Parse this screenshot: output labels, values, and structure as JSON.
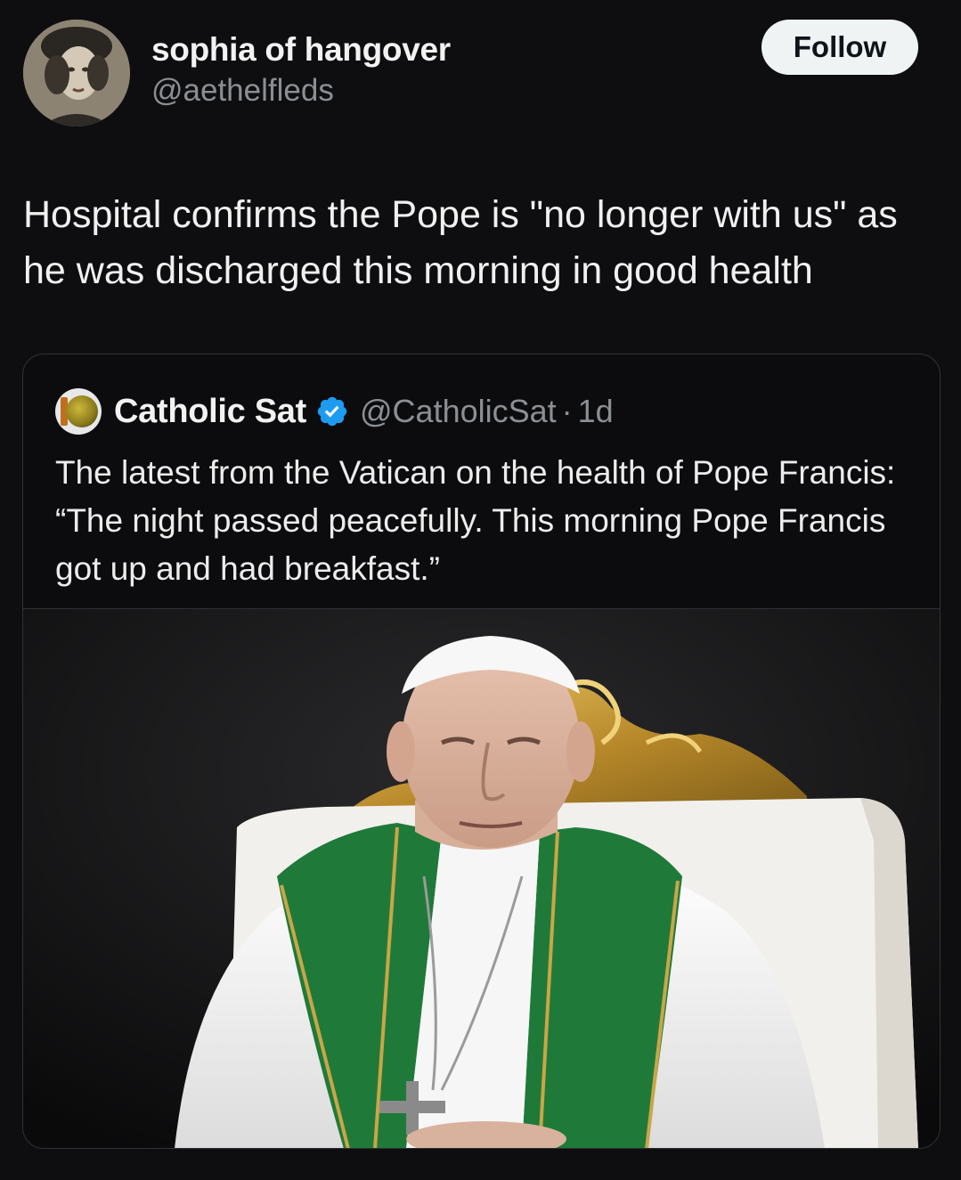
{
  "tweet": {
    "author": {
      "display_name": "sophia of hangover",
      "handle": "@aethelfleds"
    },
    "follow_label": "Follow",
    "text": "Hospital confirms the Pope is \"no longer with us\" as he was discharged this morning in good health"
  },
  "quoted_tweet": {
    "author": {
      "display_name": "Catholic Sat",
      "handle": "@CatholicSat",
      "verified": true
    },
    "separator": "·",
    "time": "1d",
    "text": "The latest from the Vatican on the health of Pope Francis: “The night passed peacefully. This morning Pope Francis got up and had breakfast.”"
  },
  "icons": {
    "verified": "verified-badge-icon"
  },
  "colors": {
    "background": "#0e0e10",
    "verified_blue": "#1d9bf0",
    "follow_button_bg": "#eff3f4"
  }
}
